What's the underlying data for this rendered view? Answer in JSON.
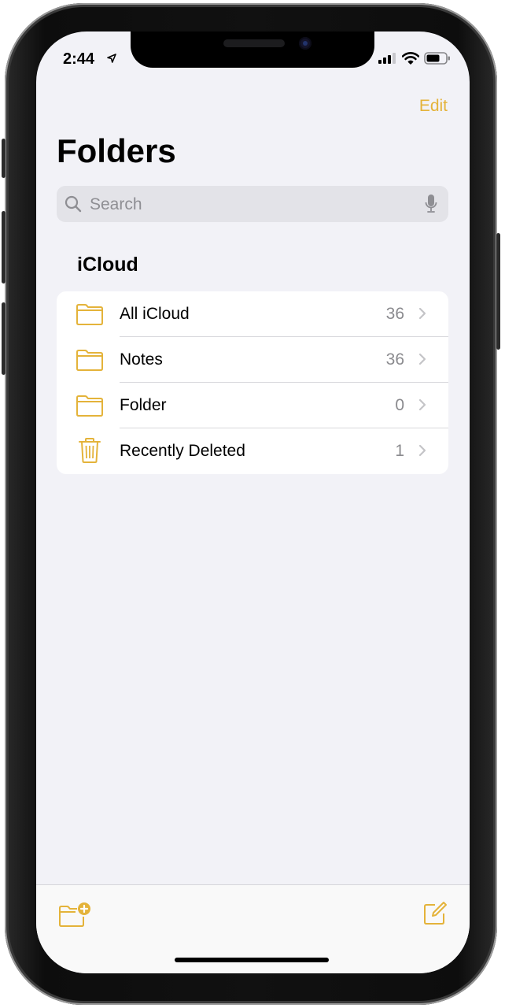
{
  "status_bar": {
    "time": "2:44"
  },
  "nav": {
    "edit_label": "Edit",
    "title": "Folders"
  },
  "search": {
    "placeholder": "Search",
    "value": ""
  },
  "section": {
    "header": "iCloud"
  },
  "folders": [
    {
      "label": "All iCloud",
      "count": "36",
      "icon": "folder-icon"
    },
    {
      "label": "Notes",
      "count": "36",
      "icon": "folder-icon"
    },
    {
      "label": "Folder",
      "count": "0",
      "icon": "folder-icon"
    },
    {
      "label": "Recently Deleted",
      "count": "1",
      "icon": "trash-icon"
    }
  ],
  "toolbar": {
    "left_icon": "new-folder-icon",
    "right_icon": "compose-icon"
  },
  "colors": {
    "accent": "#e4b33a",
    "background": "#f2f2f7",
    "secondary_text": "#8a8a8e"
  }
}
